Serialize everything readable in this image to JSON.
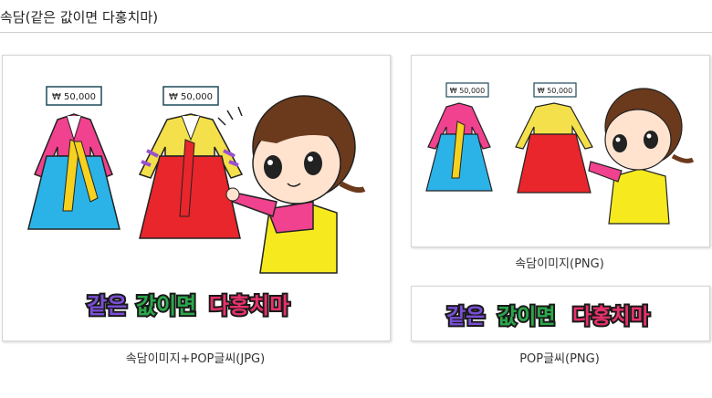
{
  "header": {
    "title": "속담(같은 값이면 다홍치마)"
  },
  "images": [
    {
      "caption": "속담이미지+POP글씨(JPG)",
      "price_tags": [
        "₩ 50,000",
        "₩ 50,000"
      ],
      "pop_words": [
        "같은",
        "값이면",
        "다홍치마"
      ]
    },
    {
      "caption": "속담이미지(PNG)",
      "price_tags": [
        "₩ 50,000",
        "₩ 50,000"
      ]
    },
    {
      "caption": "POP글씨(PNG)",
      "pop_words": [
        "같은",
        "값이면",
        "다홍치마"
      ]
    }
  ],
  "colors": {
    "pop_word_1": "#7b4fd6",
    "pop_word_2": "#2aa84a",
    "pop_word_3": "#e8316b",
    "hanbok_1_jeogori": "#f0428e",
    "hanbok_1_skirt": "#2bb3e8",
    "hanbok_2_jeogori": "#f4e04a",
    "hanbok_2_skirt": "#e8262b",
    "girl_skirt": "#f6ea1f"
  }
}
